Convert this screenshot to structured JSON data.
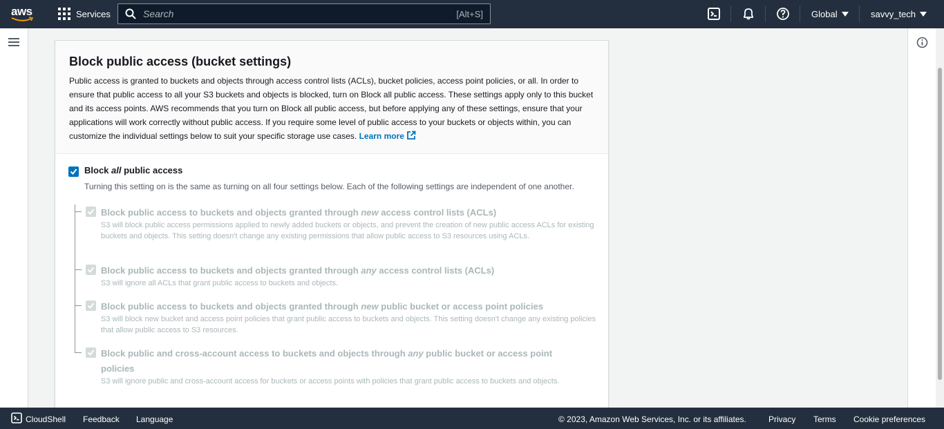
{
  "topnav": {
    "logo_text": "aws",
    "services_label": "Services",
    "search_placeholder": "Search",
    "search_shortcut": "[Alt+S]",
    "region_label": "Global",
    "user_label": "savvy_tech",
    "icons": [
      "grid-icon",
      "search-icon",
      "cloudshell-icon",
      "bell-icon",
      "help-icon",
      "chevron-down-icon"
    ]
  },
  "panel": {
    "title": "Block public access (bucket settings)",
    "description": "Public access is granted to buckets and objects through access control lists (ACLs), bucket policies, access point policies, or all. In order to ensure that public access to all your S3 buckets and objects is blocked, turn on Block all public access. These settings apply only to this bucket and its access points. AWS recommends that you turn on Block all public access, but before applying any of these settings, ensure that your applications will work correctly without public access. If you require some level of public access to your buckets or objects within, you can customize the individual settings below to suit your specific storage use cases.",
    "learn_more": "Learn more",
    "main_option": {
      "title_pre": "Block ",
      "title_em": "all",
      "title_post": " public access",
      "description": "Turning this setting on is the same as turning on all four settings below. Each of the following settings are independent of one another.",
      "checked": true
    },
    "sub_options": [
      {
        "title_pre": "Block public access to buckets and objects granted through ",
        "title_em": "new",
        "title_post": " access control lists (ACLs)",
        "description": "S3 will block public access permissions applied to newly added buckets or objects, and prevent the creation of new public access ACLs for existing buckets and objects. This setting doesn't change any existing permissions that allow public access to S3 resources using ACLs."
      },
      {
        "title_pre": "Block public access to buckets and objects granted through ",
        "title_em": "any",
        "title_post": " access control lists (ACLs)",
        "description": "S3 will ignore all ACLs that grant public access to buckets and objects."
      },
      {
        "title_pre": "Block public access to buckets and objects granted through ",
        "title_em": "new",
        "title_post": " public bucket or access point policies",
        "description": "S3 will block new bucket and access point policies that grant public access to buckets and objects. This setting doesn't change any existing policies that allow public access to S3 resources."
      },
      {
        "title_pre": "Block public and cross-account access to buckets and objects through ",
        "title_em": "any",
        "title_post": " public bucket or access point policies",
        "description": "S3 will ignore public and cross-account access for buckets or access points with policies that grant public access to buckets and objects."
      }
    ]
  },
  "footer": {
    "cloudshell": "CloudShell",
    "feedback": "Feedback",
    "language": "Language",
    "copyright": "© 2023, Amazon Web Services, Inc. or its affiliates.",
    "privacy": "Privacy",
    "terms": "Terms",
    "cookies": "Cookie preferences"
  },
  "colors": {
    "nav_bg": "#232f3e",
    "accent": "#0073bb",
    "disabled_text": "#aab7b8",
    "page_bg": "#f2f3f3"
  }
}
